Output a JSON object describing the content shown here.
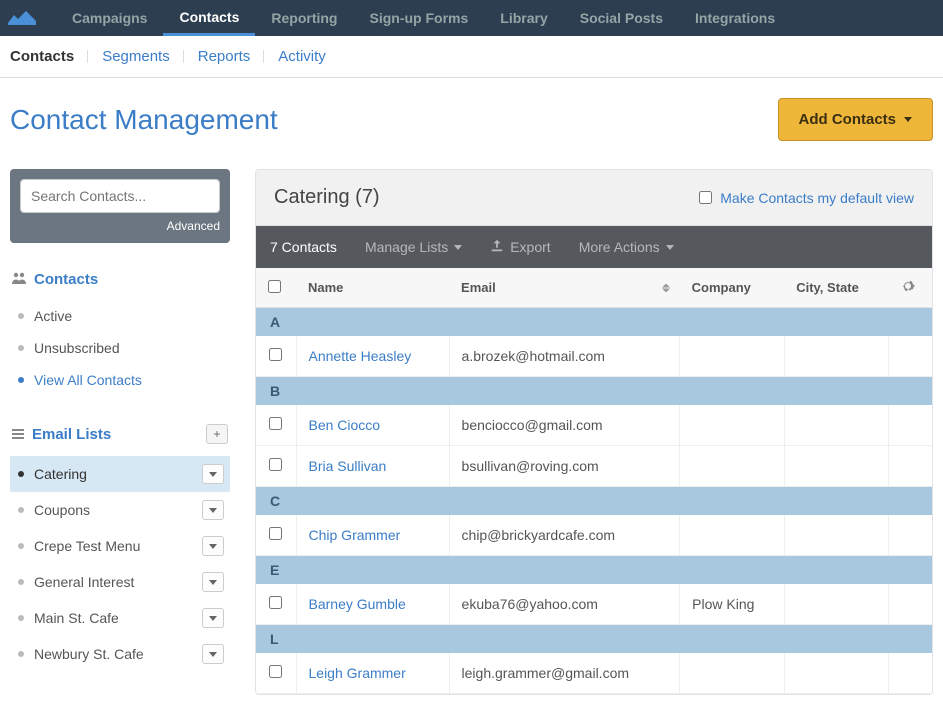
{
  "topnav": [
    "Campaigns",
    "Contacts",
    "Reporting",
    "Sign-up Forms",
    "Library",
    "Social Posts",
    "Integrations"
  ],
  "topnav_active": 1,
  "subnav": [
    "Contacts",
    "Segments",
    "Reports",
    "Activity"
  ],
  "subnav_active": 0,
  "page_title": "Contact Management",
  "add_button": "Add Contacts",
  "search": {
    "placeholder": "Search Contacts...",
    "advanced": "Advanced"
  },
  "side_contacts": {
    "heading": "Contacts",
    "items": [
      {
        "label": "Active"
      },
      {
        "label": "Unsubscribed"
      },
      {
        "label": "View All Contacts",
        "link": true
      }
    ]
  },
  "side_lists": {
    "heading": "Email Lists",
    "items": [
      {
        "label": "Catering",
        "selected": true
      },
      {
        "label": "Coupons"
      },
      {
        "label": "Crepe Test Menu"
      },
      {
        "label": "General Interest"
      },
      {
        "label": "Main St. Cafe"
      },
      {
        "label": "Newbury St. Cafe"
      }
    ]
  },
  "panel": {
    "title": "Catering (7)",
    "default_view": "Make Contacts my default view"
  },
  "toolbar": {
    "count": "7 Contacts",
    "manage": "Manage Lists",
    "export": "Export",
    "more": "More Actions"
  },
  "columns": [
    "Name",
    "Email",
    "Company",
    "City, State"
  ],
  "groups": [
    {
      "letter": "A",
      "rows": [
        {
          "name": "Annette Heasley",
          "email": "a.brozek@hotmail.com",
          "company": "",
          "city": ""
        }
      ]
    },
    {
      "letter": "B",
      "rows": [
        {
          "name": "Ben Ciocco",
          "email": "benciocco@gmail.com",
          "company": "",
          "city": ""
        },
        {
          "name": "Bria Sullivan",
          "email": "bsullivan@roving.com",
          "company": "",
          "city": ""
        }
      ]
    },
    {
      "letter": "C",
      "rows": [
        {
          "name": "Chip Grammer",
          "email": "chip@brickyardcafe.com",
          "company": "",
          "city": ""
        }
      ]
    },
    {
      "letter": "E",
      "rows": [
        {
          "name": "Barney Gumble",
          "email": "ekuba76@yahoo.com",
          "company": "Plow King",
          "city": ""
        }
      ]
    },
    {
      "letter": "L",
      "rows": [
        {
          "name": "Leigh Grammer",
          "email": "leigh.grammer@gmail.com",
          "company": "",
          "city": ""
        }
      ]
    }
  ]
}
